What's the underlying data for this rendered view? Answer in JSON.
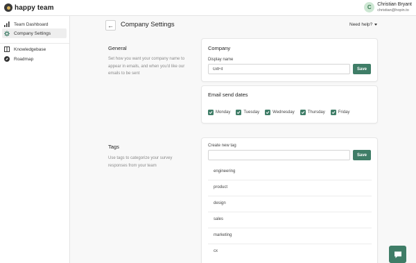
{
  "app": {
    "brand": "happy team"
  },
  "user": {
    "initial": "C",
    "name": "Christian Bryant",
    "email": "christian@hopin.to"
  },
  "sidebar": {
    "items": [
      {
        "label": "Team Dashboard",
        "icon": "bar-chart-icon"
      },
      {
        "label": "Company Settings",
        "icon": "gear-icon"
      },
      {
        "label": "Knowledgebase",
        "icon": "book-icon"
      },
      {
        "label": "Roadmap",
        "icon": "compass-icon"
      }
    ]
  },
  "header": {
    "title": "Company Settings",
    "help": "Need help?"
  },
  "general": {
    "title": "General",
    "description": "Set how you want your company name to appear in emails, and when you'd like our emails to be sent"
  },
  "company_card": {
    "title": "Company",
    "display_name_label": "Display name",
    "display_name_value": "GitFit",
    "save_label": "Save"
  },
  "email_card": {
    "title": "Email send dates",
    "days": [
      {
        "label": "Monday",
        "checked": true
      },
      {
        "label": "Tuesday",
        "checked": true
      },
      {
        "label": "Wednesday",
        "checked": true
      },
      {
        "label": "Thursday",
        "checked": true
      },
      {
        "label": "Friday",
        "checked": true
      }
    ]
  },
  "tags": {
    "title": "Tags",
    "description": "Use tags to categorize your survey responses from your team",
    "create_label": "Create new tag",
    "create_value": "",
    "save_label": "Save",
    "items": [
      "engineering",
      "product",
      "design",
      "sales",
      "marketing",
      "cx"
    ]
  },
  "colors": {
    "accent": "#3f7d67",
    "avatar_bg": "#cde7d3"
  }
}
